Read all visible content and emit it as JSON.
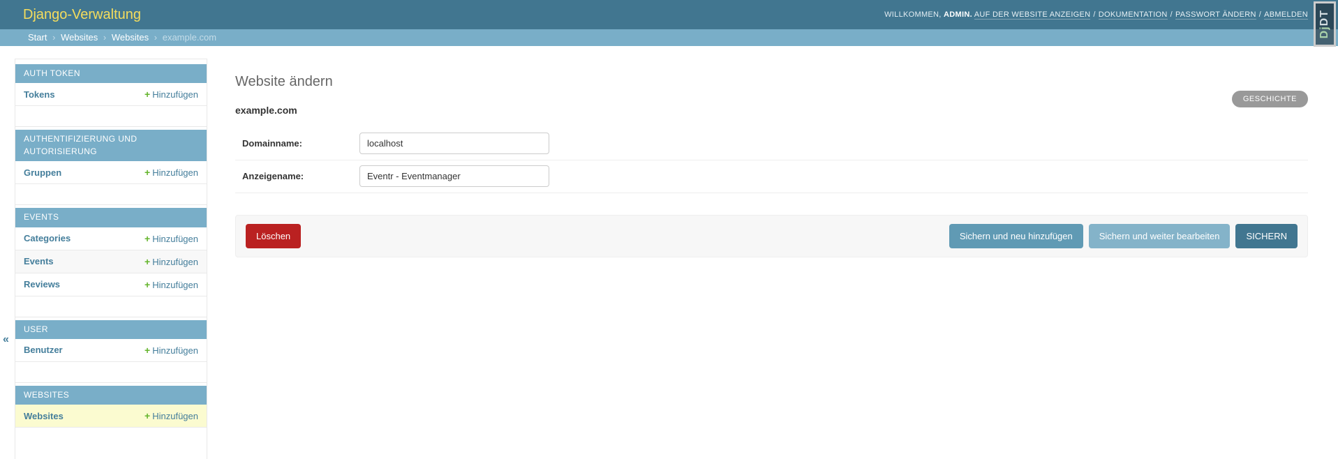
{
  "header": {
    "title": "Django-Verwaltung",
    "user_tools": {
      "welcome": "WILLKOMMEN,",
      "username": "ADMIN.",
      "separator": "/",
      "links": [
        "AUF DER WEBSITE ANZEIGEN",
        "DOKUMENTATION",
        "PASSWORT ÄNDERN",
        "ABMELDEN"
      ]
    }
  },
  "breadcrumbs": {
    "separator": "›",
    "links": [
      "Start",
      "Websites",
      "Websites"
    ],
    "current": "example.com"
  },
  "debug_toolbar": {
    "handle_dj": "Dj",
    "handle_dt": "DT"
  },
  "sidebar": {
    "collapse_icon": "«",
    "add_icon": "+",
    "add_label": "Hinzufügen",
    "sections": [
      {
        "caption": "AUTH TOKEN",
        "models": [
          {
            "name": "Tokens"
          }
        ]
      },
      {
        "caption": "AUTHENTIFIZIERUNG UND AUTORISIERUNG",
        "models": [
          {
            "name": "Gruppen"
          }
        ]
      },
      {
        "caption": "EVENTS",
        "models": [
          {
            "name": "Categories"
          },
          {
            "name": "Events"
          },
          {
            "name": "Reviews"
          }
        ]
      },
      {
        "caption": "USER",
        "models": [
          {
            "name": "Benutzer"
          }
        ]
      },
      {
        "caption": "WEBSITES",
        "models": [
          {
            "name": "Websites"
          }
        ]
      }
    ]
  },
  "main": {
    "object_tools": {
      "history_label": "GESCHICHTE"
    },
    "title": "Website ändern",
    "object_name": "example.com",
    "form": {
      "fields": [
        {
          "label": "Domainname:",
          "value": "localhost"
        },
        {
          "label": "Anzeigename:",
          "value": "Eventr - Eventmanager"
        }
      ]
    },
    "submit_row": {
      "delete_label": "Löschen",
      "save_add_label": "Sichern und neu hinzufügen",
      "save_continue_label": "Sichern und weiter bearbeiten",
      "save_label": "SICHERN"
    }
  },
  "colors": {
    "header_bg": "#417690",
    "breadcrumb_bg": "#79aec8",
    "brand_yellow": "#f5dd5d",
    "link_blue": "#447e9b",
    "add_green": "#64b52c",
    "delete_red": "#ba2121",
    "current_row_highlight": "#fbfbd0",
    "history_gray": "#999999"
  }
}
